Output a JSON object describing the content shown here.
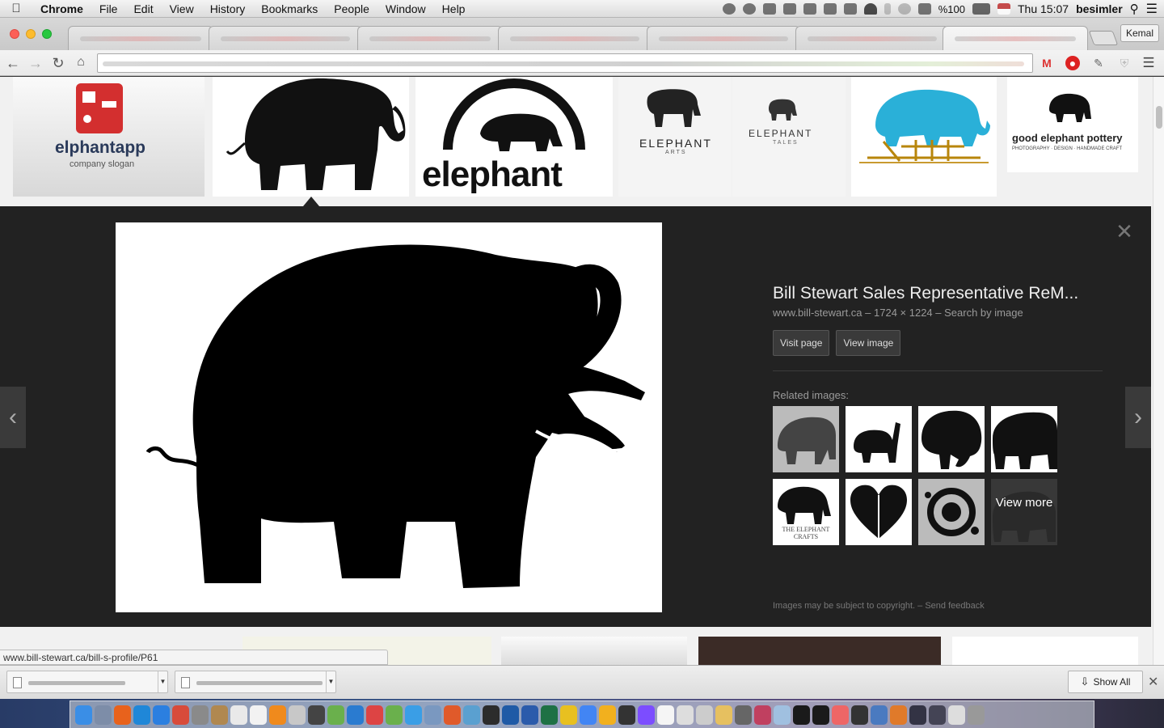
{
  "menubar": {
    "app_name": "Chrome",
    "menus": [
      "File",
      "Edit",
      "View",
      "History",
      "Bookmarks",
      "People",
      "Window",
      "Help"
    ],
    "battery": "%100",
    "datetime": "Thu 15:07",
    "user": "besimler"
  },
  "tabbar": {
    "profile_name": "Kemal"
  },
  "thumbnails": {
    "items": [
      {
        "caption": "elphantapp",
        "sub": "company slogan"
      },
      {
        "caption": ""
      },
      {
        "caption": "elephant"
      },
      {
        "caption": "ELEPHANT",
        "sub": "ARTS"
      },
      {
        "caption": "ELEPHANT",
        "sub": "TALES"
      },
      {
        "caption": ""
      },
      {
        "caption": "good elephant pottery",
        "sub": "PHOTOGRAPHY · DESIGN · HANDMADE CRAFT"
      }
    ]
  },
  "preview": {
    "title": "Bill Stewart Sales Representative ReM...",
    "domain": "www.bill-stewart.ca",
    "size": "1724 × 1224",
    "search_by_image": "Search by image",
    "visit_page": "Visit page",
    "view_image": "View image",
    "related_label": "Related images:",
    "view_more": "View more",
    "copyright_note": "Images may be subject to copyright.",
    "send_feedback": "Send feedback",
    "related_captions": [
      "",
      "",
      "",
      "",
      "THE ELEPHANT CRAFTS",
      "",
      "",
      ""
    ]
  },
  "status": {
    "url": "www.bill-stewart.ca/bill-s-profile/P61"
  },
  "downloads": {
    "show_all": "Show All"
  },
  "colors": {
    "accent_red": "#d32f2f",
    "panel_bg": "#222222",
    "teal_elephant": "#2ab0d8"
  }
}
